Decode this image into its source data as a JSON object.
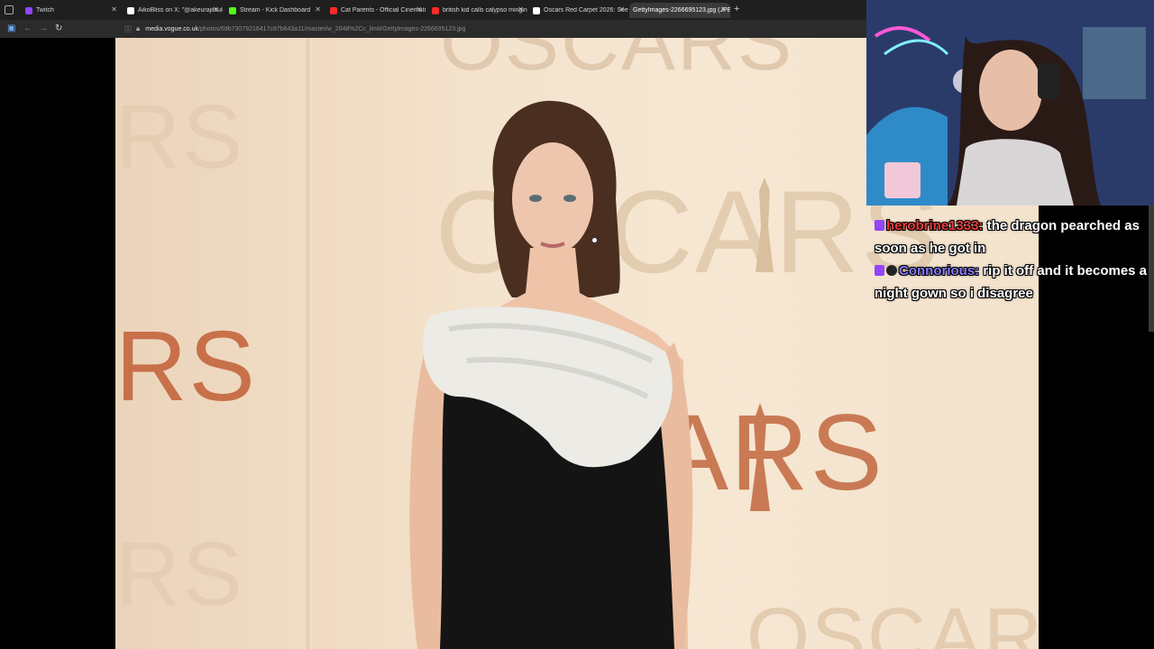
{
  "browser": {
    "tabs": [
      {
        "label": "Twitch",
        "favicon_color": "#9146ff",
        "icon": "twitch-icon"
      },
      {
        "label": "AikoBliss on X: \"@akeurajitsuki",
        "favicon_color": "#ffffff",
        "icon": "x-icon"
      },
      {
        "label": "Stream - Kick Dashboard",
        "favicon_color": "#53fc18",
        "icon": "kick-icon"
      },
      {
        "label": "Cat Parents - Official Cinematic",
        "favicon_color": "#ff2a2a",
        "icon": "youtube-icon"
      },
      {
        "label": "british kid calls calypso minging",
        "favicon_color": "#ff2a2a",
        "icon": "youtube-icon"
      },
      {
        "label": "Oscars Red Carpet 2026: See E",
        "favicon_color": "#ffffff",
        "icon": "vogue-icon"
      },
      {
        "label": "GettyImages-2266695123.jpg (JPEG",
        "favicon_color": "#888888",
        "icon": "image-icon"
      }
    ],
    "active_tab_index": 6,
    "new_tab_symbol": "+",
    "close_symbol": "✕",
    "url": {
      "prefix": "",
      "host": "media.vogue.co.uk",
      "path": "/photos/69b73079216417c87b643a11/master/w_2048%2Cc_limit/GettyImages-2266695123.jpg"
    }
  },
  "image": {
    "logo_texts": [
      "OSCARS",
      "RS",
      "ARS",
      "RS",
      "SCARS",
      "OSCARS"
    ]
  },
  "stream_chat": {
    "messages": [
      {
        "user": "herobrine1333:",
        "text": "the dragon pearched as soon as he got in",
        "user_color": "#e83a3a"
      },
      {
        "user": "Connorious:",
        "text": "rip it off and it becomes a night gown so i disagree",
        "user_color": "#8a7cff"
      }
    ]
  }
}
